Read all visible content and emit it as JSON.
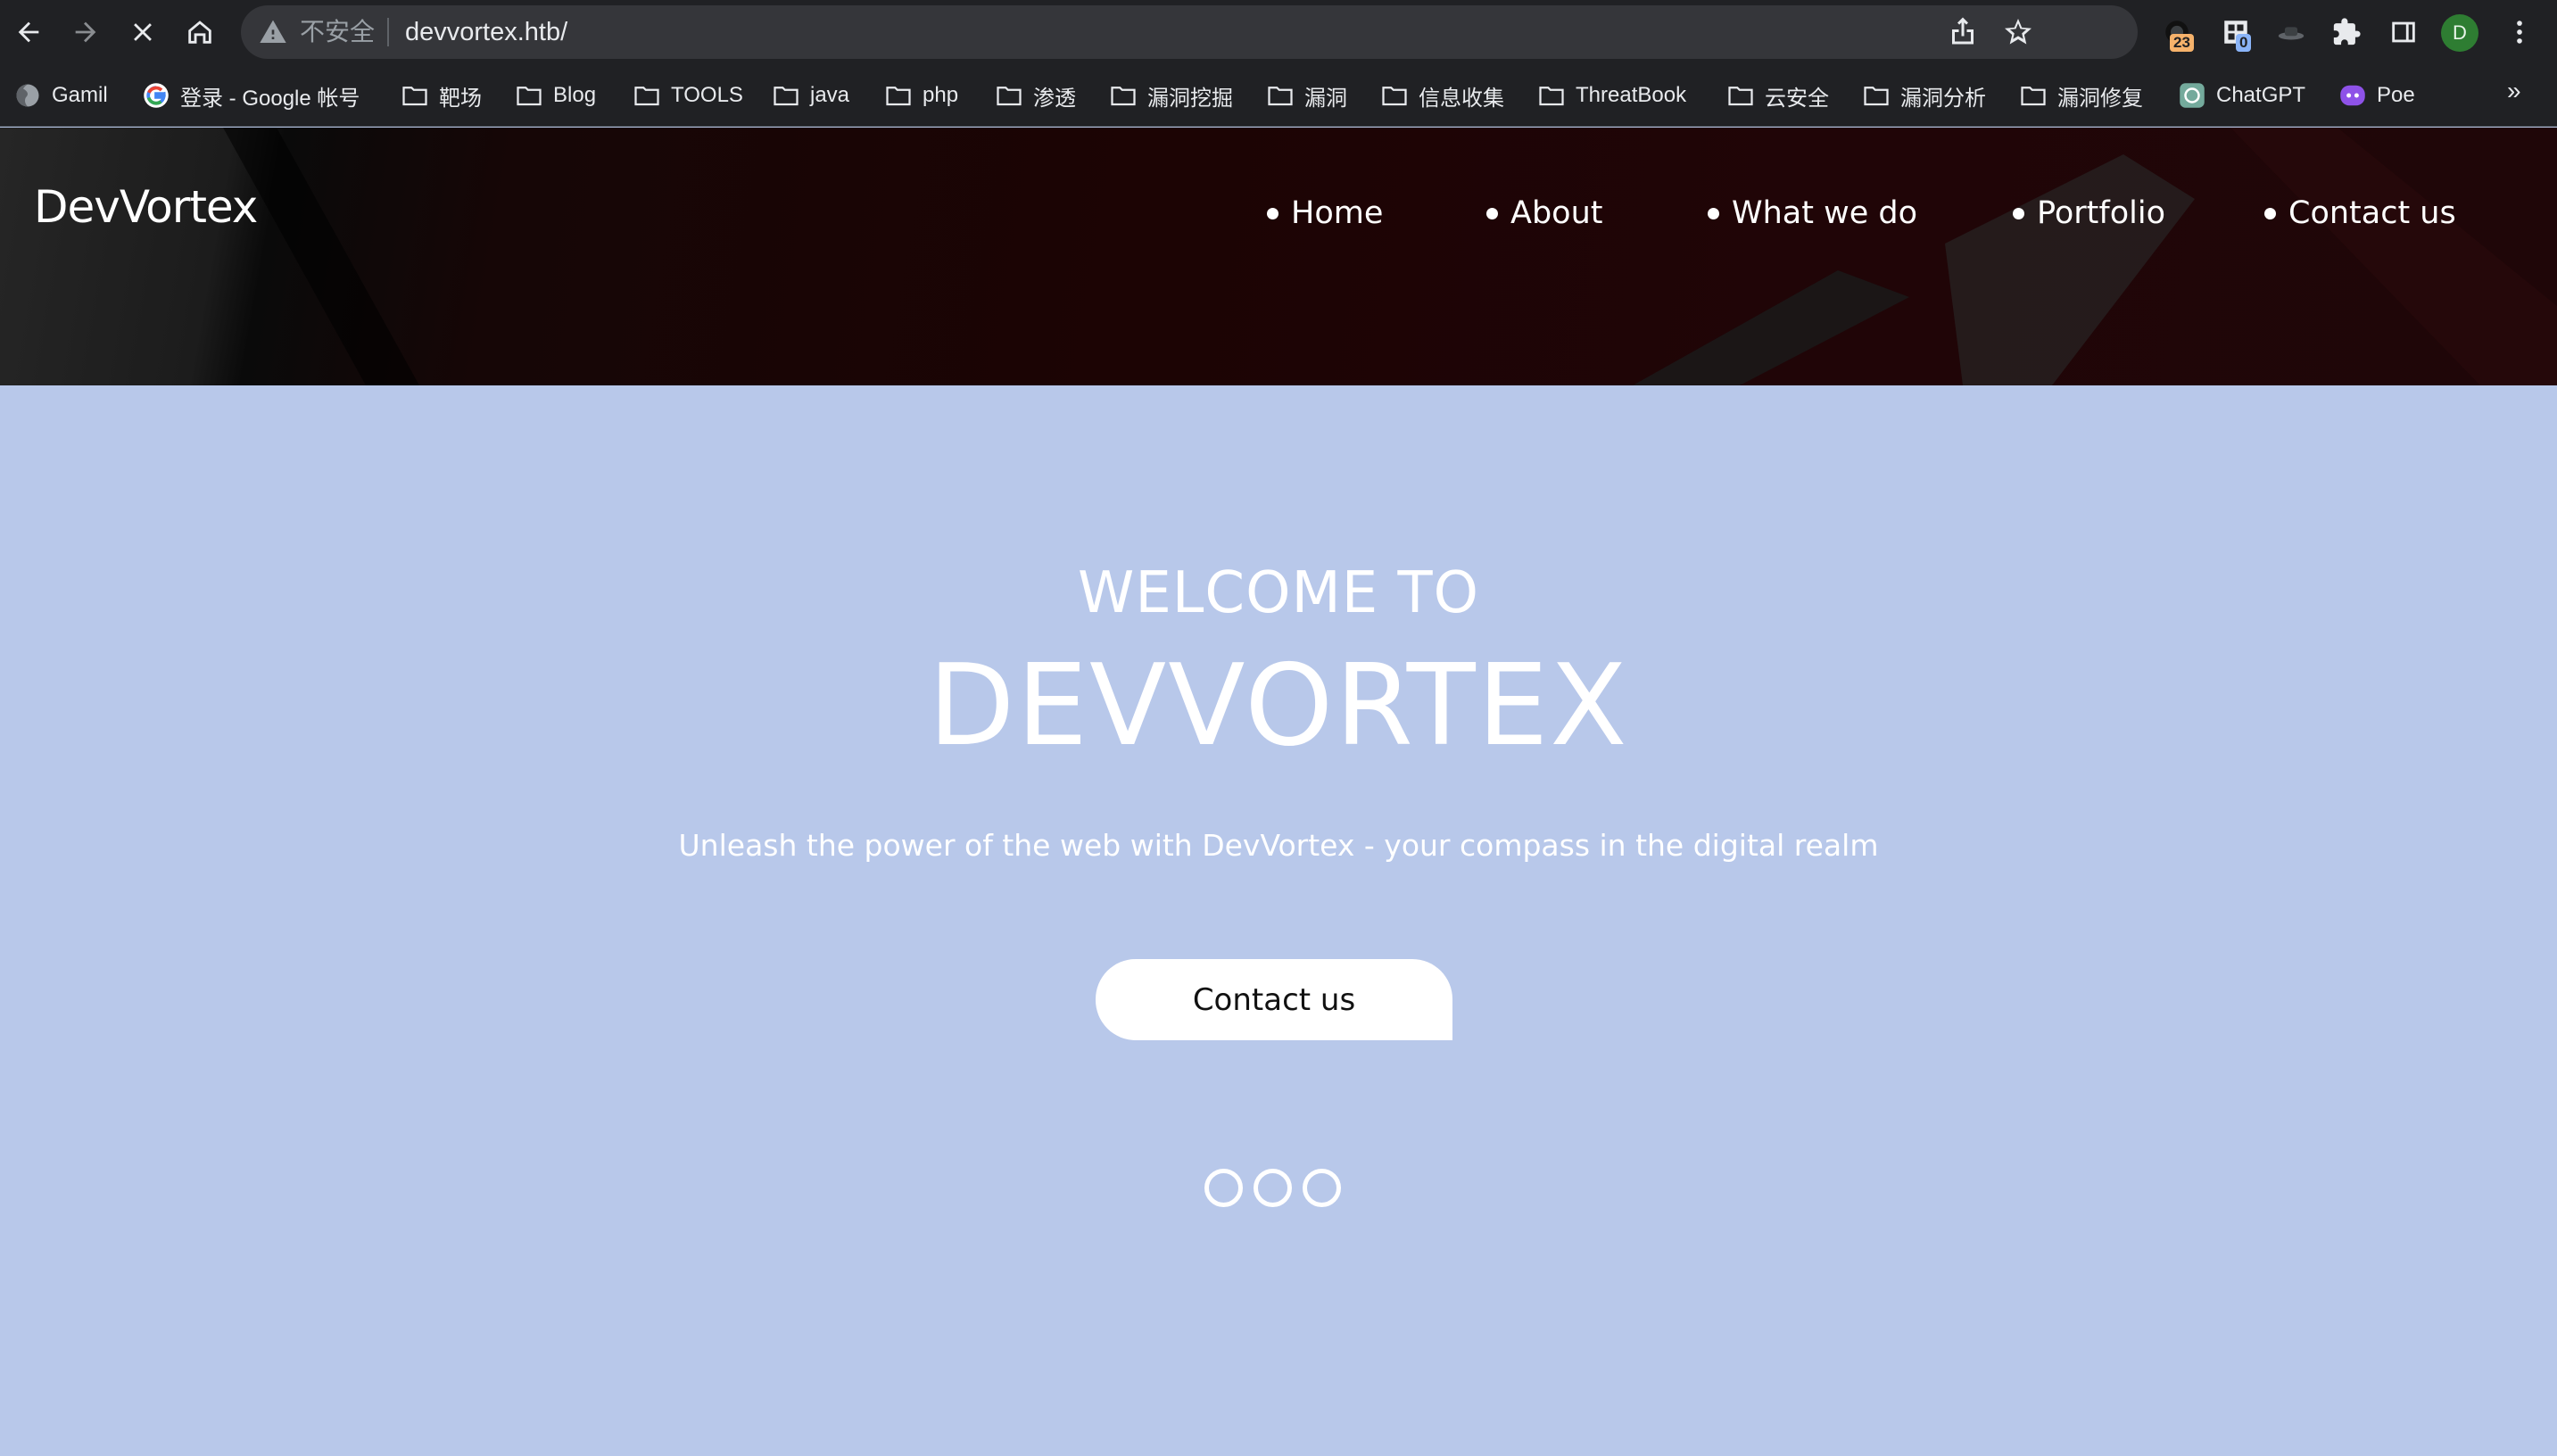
{
  "browser": {
    "security_label": "不安全",
    "url": "devvortex.htb/",
    "extensions": [
      {
        "icon": "extension-badge-icon",
        "badge": "23",
        "badge_color": "#f6b26b"
      },
      {
        "icon": "qr-extension-icon",
        "badge": "0",
        "badge_color": "#8ab4f8"
      },
      {
        "icon": "hat-extension-icon"
      },
      {
        "icon": "puzzle-icon"
      },
      {
        "icon": "side-panel-icon"
      }
    ],
    "profile_initial": "D",
    "profile_color": "#2e7d32"
  },
  "bookmarks": {
    "items": [
      {
        "label": "Gamil",
        "icon": "globe-icon"
      },
      {
        "label": "登录 - Google 帐号",
        "icon": "google-icon"
      },
      {
        "label": "靶场",
        "icon": "folder-icon"
      },
      {
        "label": "Blog",
        "icon": "folder-icon"
      },
      {
        "label": "TOOLS",
        "icon": "folder-icon"
      },
      {
        "label": "java",
        "icon": "folder-icon"
      },
      {
        "label": "php",
        "icon": "folder-icon"
      },
      {
        "label": "渗透",
        "icon": "folder-icon"
      },
      {
        "label": "漏洞挖掘",
        "icon": "folder-icon"
      },
      {
        "label": "漏洞",
        "icon": "folder-icon"
      },
      {
        "label": "信息收集",
        "icon": "folder-icon"
      },
      {
        "label": "ThreatBook",
        "icon": "folder-icon"
      },
      {
        "label": "云安全",
        "icon": "folder-icon"
      },
      {
        "label": "漏洞分析",
        "icon": "folder-icon"
      },
      {
        "label": "漏洞修复",
        "icon": "folder-icon"
      },
      {
        "label": "ChatGPT",
        "icon": "chatgpt-icon"
      },
      {
        "label": "Poe",
        "icon": "poe-icon"
      }
    ],
    "more": "»"
  },
  "site": {
    "logo": "DevVortex",
    "nav": [
      {
        "label": "Home"
      },
      {
        "label": "About"
      },
      {
        "label": "What we do"
      },
      {
        "label": "Portfolio"
      },
      {
        "label": "Contact us"
      }
    ]
  },
  "hero": {
    "welcome": "WELCOME TO",
    "brand": "DEVVORTEX",
    "tagline": "Unleash the power of the web with DevVortex - your compass in the digital realm",
    "cta": "Contact us",
    "slides": 3,
    "background": "#b8c8ea"
  }
}
